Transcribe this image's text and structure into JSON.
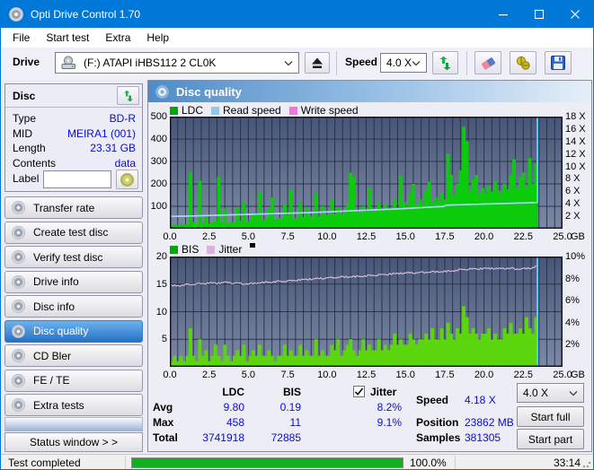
{
  "window": {
    "title": "Opti Drive Control 1.70"
  },
  "menu": {
    "items": [
      "File",
      "Start test",
      "Extra",
      "Help"
    ]
  },
  "toolbar": {
    "drive_label": "Drive",
    "drive_value": "(F:)   ATAPI iHBS112   2 CL0K",
    "speed_label": "Speed",
    "speed_value": "4.0 X"
  },
  "disc_panel": {
    "title": "Disc",
    "rows": [
      {
        "label": "Type",
        "value": "BD-R"
      },
      {
        "label": "MID",
        "value": "MEIRA1 (001)"
      },
      {
        "label": "Length",
        "value": "23.31 GB"
      },
      {
        "label": "Contents",
        "value": "data"
      }
    ],
    "label_field": {
      "label": "Label",
      "value": ""
    }
  },
  "sidebar": {
    "items": [
      {
        "label": "Transfer rate",
        "active": false
      },
      {
        "label": "Create test disc",
        "active": false
      },
      {
        "label": "Verify test disc",
        "active": false
      },
      {
        "label": "Drive info",
        "active": false
      },
      {
        "label": "Disc info",
        "active": false
      },
      {
        "label": "Disc quality",
        "active": true
      },
      {
        "label": "CD Bler",
        "active": false
      },
      {
        "label": "FE / TE",
        "active": false
      },
      {
        "label": "Extra tests",
        "active": false
      }
    ],
    "status_window_label": "Status window > >"
  },
  "panel": {
    "title": "Disc quality"
  },
  "colors": {
    "titlebar": "#0078d7",
    "value_text": "#0a0adc",
    "plot_top": "#475677",
    "plot_bottom": "#7d89a5",
    "grid": "#232c42",
    "end_marker": "#5fc8f5"
  },
  "chart_data": [
    {
      "type": "bar",
      "legend": [
        {
          "label": "LDC",
          "color": "#00a800"
        },
        {
          "label": "Read speed",
          "color": "#8cc8f0"
        },
        {
          "label": "Write speed",
          "color": "#f078d8"
        }
      ],
      "extra_marker": false,
      "x_axis": {
        "labels": [
          "0.0",
          "2.5",
          "5.0",
          "7.5",
          "10.0",
          "12.5",
          "15.0",
          "17.5",
          "20.0",
          "22.5",
          "25.0"
        ],
        "values": [
          0,
          2.5,
          5,
          7.5,
          10,
          12.5,
          15,
          17.5,
          20,
          22.5,
          25
        ],
        "max": 25,
        "unit": "GB",
        "grid_step": 0.5
      },
      "y_left": {
        "labels": [
          "100",
          "200",
          "300",
          "400",
          "500"
        ],
        "values": [
          100,
          200,
          300,
          400,
          500
        ],
        "max": 500
      },
      "y_right": {
        "labels": [
          "2 X",
          "4 X",
          "6 X",
          "8 X",
          "10 X",
          "12 X",
          "14 X",
          "16 X",
          "18 X"
        ],
        "values": [
          2,
          4,
          6,
          8,
          10,
          12,
          14,
          16,
          18
        ],
        "max": 18
      },
      "bars": {
        "name": "LDC",
        "color": "#0acc0a",
        "step": 0.2,
        "values": [
          12,
          18,
          15,
          22,
          16,
          20,
          250,
          30,
          18,
          215,
          25,
          60,
          22,
          28,
          35,
          230,
          28,
          90,
          24,
          30,
          26,
          95,
          34,
          120,
          30,
          38,
          70,
          60,
          165,
          36,
          42,
          90,
          140,
          40,
          45,
          48,
          110,
          60,
          175,
          46,
          50,
          120,
          52,
          90,
          55,
          58,
          160,
          55,
          100,
          60,
          62,
          130,
          64,
          95,
          66,
          70,
          110,
          250,
          230,
          75,
          72,
          100,
          76,
          180,
          80,
          85,
          120,
          82,
          110,
          86,
          90,
          130,
          95,
          235,
          120,
          100,
          160,
          200,
          105,
          130,
          110,
          170,
          210,
          115,
          140,
          120,
          160,
          130,
          335,
          240,
          150,
          200,
          260,
          455,
          390,
          170,
          220,
          240,
          160,
          180,
          155,
          190,
          165,
          210,
          170,
          160,
          200,
          175,
          240,
          310,
          180,
          230,
          250,
          185,
          315,
          200,
          290
        ]
      },
      "line": {
        "name": "Read speed",
        "color": "#a8d4f8",
        "width": 1.7,
        "noise": 0,
        "points": [
          [
            0,
            55
          ],
          [
            1,
            56
          ],
          [
            2,
            58
          ],
          [
            3,
            60
          ],
          [
            4,
            62
          ],
          [
            5,
            64
          ],
          [
            6,
            66
          ],
          [
            7,
            68
          ],
          [
            8,
            70
          ],
          [
            9,
            72
          ],
          [
            10,
            75
          ],
          [
            11,
            78
          ],
          [
            12,
            81
          ],
          [
            13,
            84
          ],
          [
            14,
            87
          ],
          [
            15,
            90
          ],
          [
            16,
            94
          ],
          [
            17,
            98
          ],
          [
            17.4,
            99
          ],
          [
            17.6,
            105
          ],
          [
            18,
            106
          ],
          [
            19,
            108
          ],
          [
            20,
            110
          ],
          [
            21,
            112
          ],
          [
            22,
            114
          ],
          [
            23,
            116
          ],
          [
            23.4,
            117
          ]
        ]
      },
      "end_marker": {
        "x": 23.4,
        "full": false,
        "to_value": 117
      }
    },
    {
      "type": "bar",
      "legend": [
        {
          "label": "BIS",
          "color": "#00a800"
        },
        {
          "label": "Jitter",
          "color": "#d8b4dc"
        }
      ],
      "extra_marker": true,
      "x_axis": {
        "labels": [
          "0.0",
          "2.5",
          "5.0",
          "7.5",
          "10.0",
          "12.5",
          "15.0",
          "17.5",
          "20.0",
          "22.5",
          "25.0"
        ],
        "values": [
          0,
          2.5,
          5,
          7.5,
          10,
          12.5,
          15,
          17.5,
          20,
          22.5,
          25
        ],
        "max": 25,
        "unit": "GB",
        "grid_step": 0.5
      },
      "y_left": {
        "labels": [
          "5",
          "10",
          "15",
          "20"
        ],
        "values": [
          5,
          10,
          15,
          20
        ],
        "max": 20
      },
      "y_right": {
        "labels": [
          "2%",
          "4%",
          "6%",
          "8%",
          "10%"
        ],
        "values": [
          2,
          4,
          6,
          8,
          10
        ],
        "max": 10
      },
      "bars": {
        "name": "BIS",
        "color": "#5cd60c",
        "step": 0.2,
        "values": [
          1,
          2,
          1,
          2,
          1,
          2,
          7,
          2,
          1,
          5,
          2,
          3,
          1,
          2,
          4,
          2,
          1,
          4,
          2,
          1,
          2,
          3,
          2,
          4,
          1,
          2,
          3,
          2,
          4,
          2,
          2,
          3,
          2,
          1,
          2,
          2,
          4,
          2,
          3,
          2,
          2,
          4,
          2,
          3,
          2,
          2,
          5,
          2,
          3,
          2,
          2,
          4,
          3,
          5,
          2,
          3,
          4,
          5,
          3,
          2,
          3,
          5,
          3,
          4,
          3,
          3,
          5,
          3,
          4,
          3,
          4,
          6,
          4,
          5,
          4,
          4,
          6,
          5,
          4,
          5,
          5,
          6,
          5,
          7,
          5,
          5,
          7,
          5,
          8,
          6,
          5,
          7,
          6,
          11,
          9,
          6,
          7,
          6,
          5,
          6,
          6,
          7,
          5,
          6,
          5,
          5,
          7,
          6,
          8,
          6,
          6,
          7,
          6,
          9,
          7,
          6,
          9
        ]
      },
      "line": {
        "name": "Jitter",
        "color": "#e0c2e0",
        "width": 1.1,
        "noise": 0.14,
        "points": [
          [
            0,
            14.75
          ],
          [
            0.5,
            14.7
          ],
          [
            1,
            14.9
          ],
          [
            1.5,
            15.0
          ],
          [
            2,
            15.1
          ],
          [
            2.5,
            15.2
          ],
          [
            3,
            15.15
          ],
          [
            3.5,
            15.3
          ],
          [
            4,
            15.2
          ],
          [
            4.5,
            15.1
          ],
          [
            5,
            15.0
          ],
          [
            5.5,
            15.2
          ],
          [
            6,
            15.3
          ],
          [
            6.5,
            15.4
          ],
          [
            7,
            15.5
          ],
          [
            7.5,
            15.55
          ],
          [
            8,
            15.7
          ],
          [
            8.5,
            15.8
          ],
          [
            9,
            15.9
          ],
          [
            9.5,
            16.0
          ],
          [
            10,
            16.1
          ],
          [
            10.5,
            16.2
          ],
          [
            11,
            16.3
          ],
          [
            11.5,
            16.35
          ],
          [
            12,
            16.4
          ],
          [
            12.5,
            16.5
          ],
          [
            13,
            16.6
          ],
          [
            13.5,
            16.7
          ],
          [
            14,
            16.8
          ],
          [
            14.5,
            16.9
          ],
          [
            15,
            17.0
          ],
          [
            15.5,
            17.05
          ],
          [
            16,
            17.1
          ],
          [
            16.5,
            17.2
          ],
          [
            17,
            17.25
          ],
          [
            17.5,
            17.3
          ],
          [
            18,
            17.4
          ],
          [
            18.5,
            17.6
          ],
          [
            19,
            17.7
          ],
          [
            19.5,
            17.75
          ],
          [
            20,
            17.8
          ],
          [
            20.5,
            17.85
          ],
          [
            21,
            17.8
          ],
          [
            21.5,
            17.9
          ],
          [
            22,
            17.75
          ],
          [
            22.5,
            17.8
          ],
          [
            23,
            17.9
          ],
          [
            23.4,
            18.3
          ]
        ]
      },
      "end_marker": {
        "x": 23.4,
        "full": true,
        "to_value": 0
      }
    }
  ],
  "stats": {
    "col_headers": [
      "LDC",
      "BIS"
    ],
    "jitter_checkbox": {
      "label": "Jitter",
      "checked": true
    },
    "rows": [
      {
        "label": "Avg",
        "ldc": "9.80",
        "bis": "0.19",
        "jitter": "8.2%"
      },
      {
        "label": "Max",
        "ldc": "458",
        "bis": "11",
        "jitter": "9.1%"
      },
      {
        "label": "Total",
        "ldc": "3741918",
        "bis": "72885",
        "jitter": ""
      }
    ],
    "info": [
      {
        "label": "Speed",
        "value": "4.18 X"
      },
      {
        "label": "Position",
        "value": "23862 MB"
      },
      {
        "label": "Samples",
        "value": "381305"
      }
    ],
    "speed_select": "4.0 X",
    "buttons": [
      "Start full",
      "Start part"
    ]
  },
  "statusbar": {
    "message": "Test completed",
    "progress_pct": 100,
    "progress_label": "100.0%",
    "time": "33:14"
  }
}
